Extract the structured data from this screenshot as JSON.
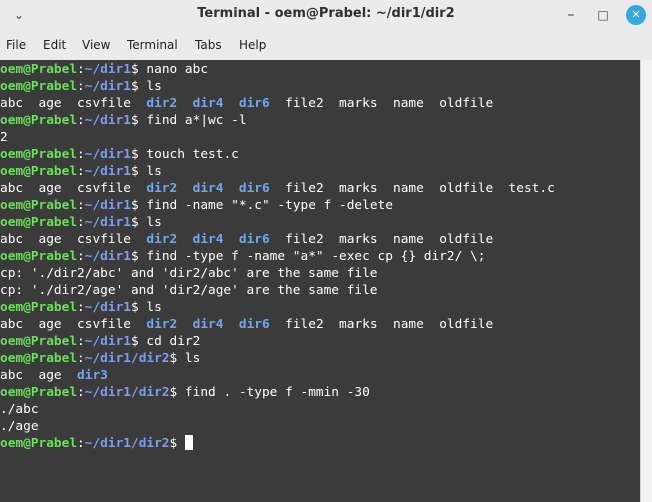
{
  "window": {
    "title": "Terminal - oem@Prabel: ~/dir1/dir2"
  },
  "titlebar_icons": {
    "menu": "chevron-down-icon",
    "minimize": "minimize-icon",
    "maximize": "maximize-icon",
    "close": "close-icon"
  },
  "menu": [
    "File",
    "Edit",
    "View",
    "Terminal",
    "Tabs",
    "Help"
  ],
  "colors": {
    "user": "#6be05a",
    "path": "#7c9df0",
    "dir": "#6fa8f0",
    "background": "#3b3b3b",
    "text": "#ffffff",
    "close_button": "#35a8e0"
  },
  "terminal": {
    "lines": [
      [
        {
          "t": "oem@Prabel",
          "c": "u"
        },
        {
          "t": ":"
        },
        {
          "t": "~/dir1",
          "c": "p"
        },
        {
          "t": "$ nano abc"
        }
      ],
      [
        {
          "t": "oem@Prabel",
          "c": "u"
        },
        {
          "t": ":"
        },
        {
          "t": "~/dir1",
          "c": "p"
        },
        {
          "t": "$ ls"
        }
      ],
      [
        {
          "t": "abc  age  csvfile  "
        },
        {
          "t": "dir2",
          "c": "d"
        },
        {
          "t": "  "
        },
        {
          "t": "dir4",
          "c": "d"
        },
        {
          "t": "  "
        },
        {
          "t": "dir6",
          "c": "d"
        },
        {
          "t": "  file2  marks  name  oldfile"
        }
      ],
      [
        {
          "t": "oem@Prabel",
          "c": "u"
        },
        {
          "t": ":"
        },
        {
          "t": "~/dir1",
          "c": "p"
        },
        {
          "t": "$ find a*|wc -l"
        }
      ],
      [
        {
          "t": "2"
        }
      ],
      [
        {
          "t": "oem@Prabel",
          "c": "u"
        },
        {
          "t": ":"
        },
        {
          "t": "~/dir1",
          "c": "p"
        },
        {
          "t": "$ touch test.c"
        }
      ],
      [
        {
          "t": "oem@Prabel",
          "c": "u"
        },
        {
          "t": ":"
        },
        {
          "t": "~/dir1",
          "c": "p"
        },
        {
          "t": "$ ls"
        }
      ],
      [
        {
          "t": "abc  age  csvfile  "
        },
        {
          "t": "dir2",
          "c": "d"
        },
        {
          "t": "  "
        },
        {
          "t": "dir4",
          "c": "d"
        },
        {
          "t": "  "
        },
        {
          "t": "dir6",
          "c": "d"
        },
        {
          "t": "  file2  marks  name  oldfile  test.c"
        }
      ],
      [
        {
          "t": "oem@Prabel",
          "c": "u"
        },
        {
          "t": ":"
        },
        {
          "t": "~/dir1",
          "c": "p"
        },
        {
          "t": "$ find -name \"*.c\" -type f -delete"
        }
      ],
      [
        {
          "t": "oem@Prabel",
          "c": "u"
        },
        {
          "t": ":"
        },
        {
          "t": "~/dir1",
          "c": "p"
        },
        {
          "t": "$ ls"
        }
      ],
      [
        {
          "t": "abc  age  csvfile  "
        },
        {
          "t": "dir2",
          "c": "d"
        },
        {
          "t": "  "
        },
        {
          "t": "dir4",
          "c": "d"
        },
        {
          "t": "  "
        },
        {
          "t": "dir6",
          "c": "d"
        },
        {
          "t": "  file2  marks  name  oldfile"
        }
      ],
      [
        {
          "t": "oem@Prabel",
          "c": "u"
        },
        {
          "t": ":"
        },
        {
          "t": "~/dir1",
          "c": "p"
        },
        {
          "t": "$ find -type f -name \"a*\" -exec cp {} dir2/ \\;"
        }
      ],
      [
        {
          "t": "cp: './dir2/abc' and 'dir2/abc' are the same file"
        }
      ],
      [
        {
          "t": "cp: './dir2/age' and 'dir2/age' are the same file"
        }
      ],
      [
        {
          "t": "oem@Prabel",
          "c": "u"
        },
        {
          "t": ":"
        },
        {
          "t": "~/dir1",
          "c": "p"
        },
        {
          "t": "$ ls"
        }
      ],
      [
        {
          "t": "abc  age  csvfile  "
        },
        {
          "t": "dir2",
          "c": "d"
        },
        {
          "t": "  "
        },
        {
          "t": "dir4",
          "c": "d"
        },
        {
          "t": "  "
        },
        {
          "t": "dir6",
          "c": "d"
        },
        {
          "t": "  file2  marks  name  oldfile"
        }
      ],
      [
        {
          "t": "oem@Prabel",
          "c": "u"
        },
        {
          "t": ":"
        },
        {
          "t": "~/dir1",
          "c": "p"
        },
        {
          "t": "$ cd dir2"
        }
      ],
      [
        {
          "t": "oem@Prabel",
          "c": "u"
        },
        {
          "t": ":"
        },
        {
          "t": "~/dir1/dir2",
          "c": "p"
        },
        {
          "t": "$ ls"
        }
      ],
      [
        {
          "t": "abc  age  "
        },
        {
          "t": "dir3",
          "c": "d"
        }
      ],
      [
        {
          "t": "oem@Prabel",
          "c": "u"
        },
        {
          "t": ":"
        },
        {
          "t": "~/dir1/dir2",
          "c": "p"
        },
        {
          "t": "$ find . -type f -mmin -30"
        }
      ],
      [
        {
          "t": "./abc"
        }
      ],
      [
        {
          "t": "./age"
        }
      ],
      [
        {
          "t": "oem@Prabel",
          "c": "u"
        },
        {
          "t": ":"
        },
        {
          "t": "~/dir1/dir2",
          "c": "p"
        },
        {
          "t": "$ "
        }
      ]
    ]
  }
}
